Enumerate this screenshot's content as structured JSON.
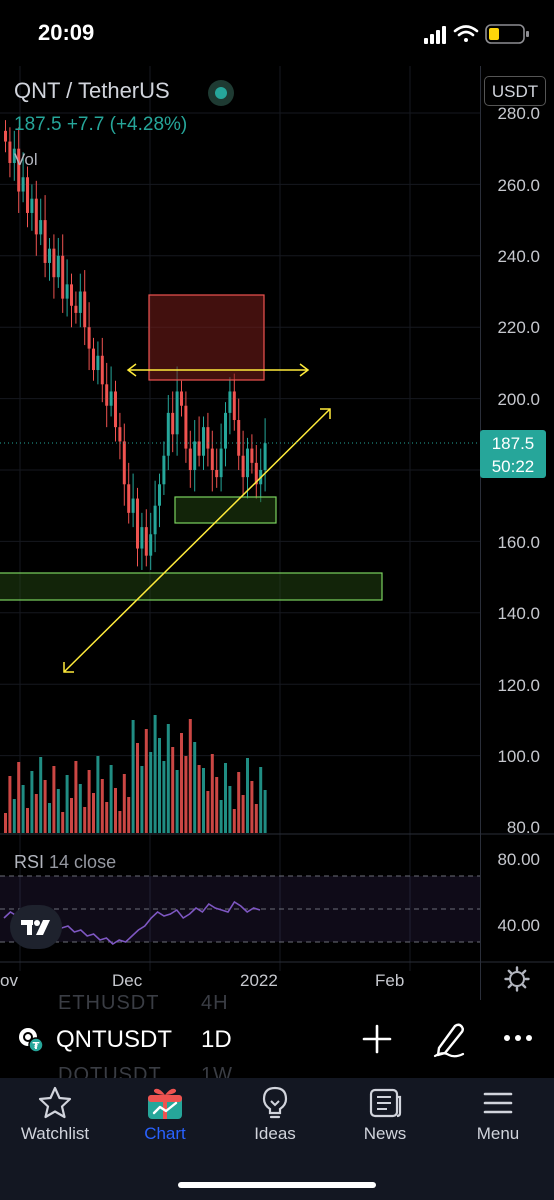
{
  "status_bar": {
    "time": "20:09"
  },
  "chart": {
    "symbol_title": "QNT / TetherUS",
    "price_change": "187.5 +7.7 (+4.28%)",
    "vol_label": "Vol",
    "currency_button": "USDT",
    "y_axis_labels": [
      "280.0",
      "260.0",
      "240.0",
      "220.0",
      "200.0",
      "160.0",
      "140.0",
      "120.0",
      "100.0",
      "80.0"
    ],
    "last_price": "187.5",
    "countdown": "50:22",
    "rsi_label": "RSI",
    "rsi_params": "14 close",
    "rsi_axis_labels": [
      "80.00",
      "40.00"
    ],
    "x_axis_labels": [
      "ov",
      "Dec",
      "2022",
      "Feb"
    ],
    "colors": {
      "up": "#26a69a",
      "down": "#ef5350",
      "background": "#000000",
      "accent": "#2962ff"
    }
  },
  "chart_data": {
    "type": "candlestick",
    "xlabel": "",
    "ylabel": "",
    "ylim": [
      80,
      280
    ],
    "price_ticks": [
      280,
      260,
      240,
      220,
      200,
      160,
      140,
      120,
      100,
      80
    ],
    "x_ticks": [
      "ov",
      "Dec",
      "2022",
      "Feb"
    ],
    "last_price": 187.5,
    "change": 7.7,
    "change_pct": 4.28,
    "rsi_period": 14,
    "rsi_source": "close",
    "rsi_ticks": [
      80,
      40
    ]
  },
  "watchlist_ghost": {
    "above": "ETHUSDT",
    "above_interval": "4H",
    "below": "DOTUSDT",
    "below_interval": "1W"
  },
  "symbol_bar": {
    "symbol": "QNTUSDT",
    "interval": "1D"
  },
  "tabs": [
    {
      "label": "Watchlist",
      "icon": "star-icon"
    },
    {
      "label": "Chart",
      "icon": "chart-gift-icon",
      "active": true
    },
    {
      "label": "Ideas",
      "icon": "lightbulb-icon"
    },
    {
      "label": "News",
      "icon": "news-icon"
    },
    {
      "label": "Menu",
      "icon": "menu-icon"
    }
  ]
}
